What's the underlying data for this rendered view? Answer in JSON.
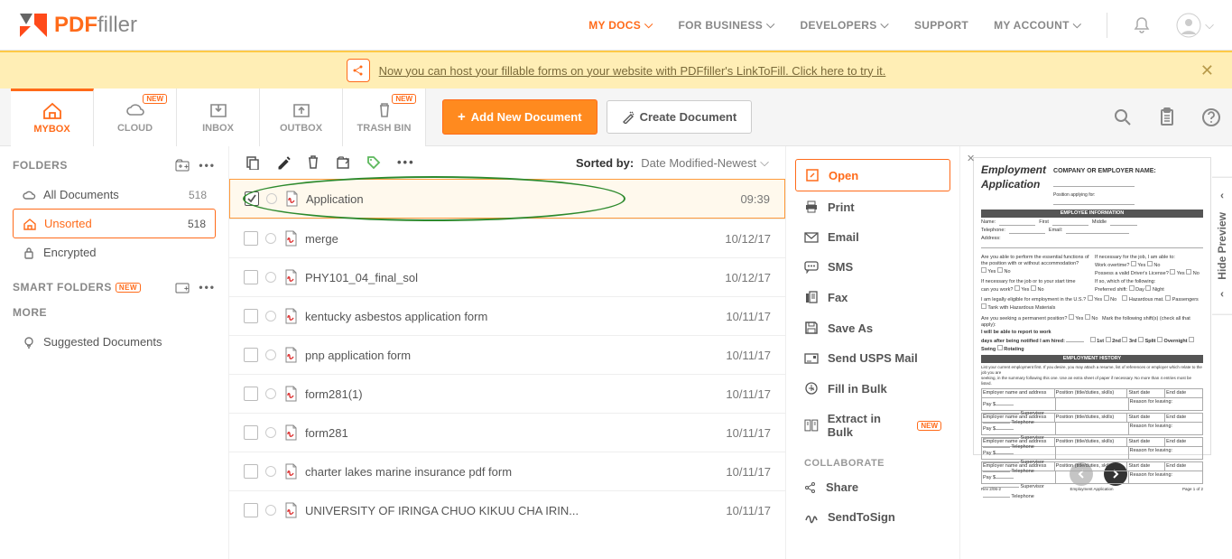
{
  "brand": {
    "pdf": "PDF",
    "filler": "filler"
  },
  "topnav": {
    "mydocs": "MY DOCS",
    "business": "FOR BUSINESS",
    "developers": "DEVELOPERS",
    "support": "SUPPORT",
    "account": "MY ACCOUNT"
  },
  "banner": {
    "text": "Now you can host your fillable forms on your website with PDFfiller's LinkToFill. Click here to try it."
  },
  "tabs": {
    "mybox": "MYBOX",
    "cloud": "CLOUD",
    "inbox": "INBOX",
    "outbox": "OUTBOX",
    "trash": "TRASH BIN",
    "new": "NEW"
  },
  "buttons": {
    "add": "Add New Document",
    "create": "Create Document"
  },
  "sidebar": {
    "folders": "FOLDERS",
    "smart": "SMART FOLDERS",
    "more": "MORE",
    "new": "NEW",
    "items": {
      "all": {
        "label": "All Documents",
        "count": "518"
      },
      "unsorted": {
        "label": "Unsorted",
        "count": "518"
      },
      "encrypted": {
        "label": "Encrypted"
      },
      "suggested": {
        "label": "Suggested Documents"
      }
    }
  },
  "sort": {
    "label": "Sorted by:",
    "value": "Date Modified-Newest"
  },
  "docs": [
    {
      "name": "Application",
      "date": "09:39",
      "selected": true
    },
    {
      "name": "merge",
      "date": "10/12/17"
    },
    {
      "name": "PHY101_04_final_sol",
      "date": "10/12/17"
    },
    {
      "name": "kentucky asbestos application form",
      "date": "10/11/17"
    },
    {
      "name": "pnp application form",
      "date": "10/11/17"
    },
    {
      "name": "form281(1)",
      "date": "10/11/17"
    },
    {
      "name": "form281",
      "date": "10/11/17"
    },
    {
      "name": "charter lakes marine insurance pdf form",
      "date": "10/11/17"
    },
    {
      "name": "UNIVERSITY OF IRINGA CHUO KIKUU CHA IRIN...",
      "date": "10/11/17"
    }
  ],
  "actions": {
    "open": "Open",
    "print": "Print",
    "email": "Email",
    "sms": "SMS",
    "fax": "Fax",
    "save": "Save As",
    "usps": "Send USPS Mail",
    "bulk": "Fill in Bulk",
    "extract": "Extract in Bulk",
    "new": "NEW",
    "collaborate": "COLLABORATE",
    "share": "Share",
    "sendtosign": "SendToSign"
  },
  "preview": {
    "hide": "Hide Preview",
    "title1": "Employment",
    "title2": "Application",
    "sub": "COMPANY OR EMPLOYER NAME:",
    "positionapplying": "Position applying for:",
    "bar1": "EMPLOYEE INFORMATION",
    "bar2": "EMPLOYMENT HISTORY"
  }
}
